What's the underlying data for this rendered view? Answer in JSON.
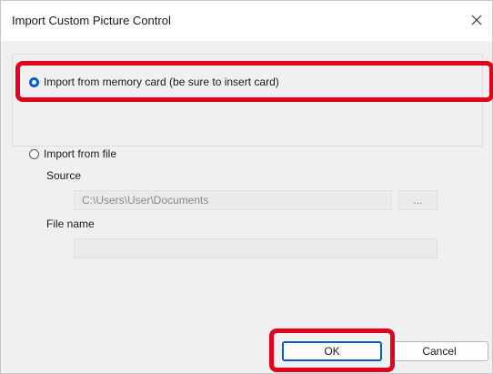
{
  "dialog": {
    "title": "Import Custom Picture Control",
    "close_icon": "close-icon"
  },
  "options": {
    "memory_card": {
      "label": "Import from memory card (be sure to insert card)",
      "checked": true
    },
    "file": {
      "label": "Import from file",
      "checked": false
    }
  },
  "file_section": {
    "source_label": "Source",
    "source_value": "C:\\Users\\User\\Documents",
    "browse_label": "...",
    "filename_label": "File name",
    "filename_value": ""
  },
  "buttons": {
    "ok_label": "OK",
    "cancel_label": "Cancel"
  },
  "colors": {
    "highlight": "#e3001b",
    "accent": "#0b5cc7"
  }
}
